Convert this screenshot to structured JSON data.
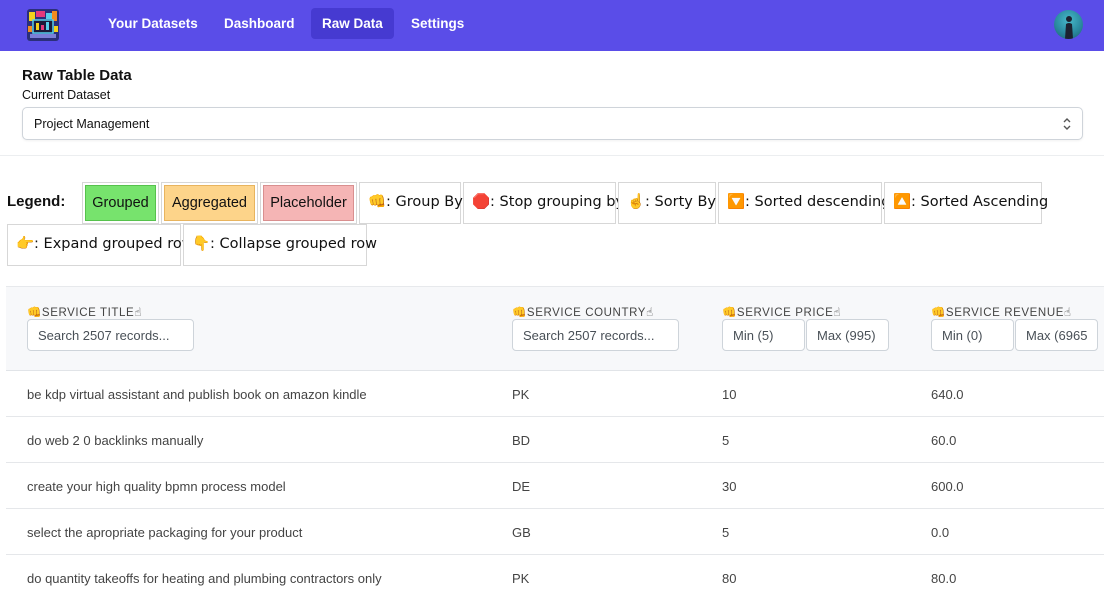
{
  "nav": {
    "items": [
      {
        "label": "Your Datasets",
        "active": false
      },
      {
        "label": "Dashboard",
        "active": false
      },
      {
        "label": "Raw Data",
        "active": true
      },
      {
        "label": "Settings",
        "active": false
      }
    ],
    "bg_color": "#5a4de8",
    "active_color": "#463ad1"
  },
  "header": {
    "title": "Raw Table Data",
    "dataset_label": "Current Dataset",
    "dataset_value": "Project Management"
  },
  "legend": {
    "title": "Legend:",
    "items": [
      {
        "label": "Grouped",
        "color": "#77e36d"
      },
      {
        "label": "Aggregated",
        "color": "#fdd48a"
      },
      {
        "label": "Placeholder",
        "color": "#f5b5b5"
      },
      {
        "label": "👊: Group By"
      },
      {
        "label": "🛑: Stop grouping by"
      },
      {
        "label": "☝️: Sorty By"
      },
      {
        "label": "🔽: Sorted descending"
      },
      {
        "label": "🔼: Sorted Ascending"
      },
      {
        "label": "👉: Expand grouped row"
      },
      {
        "label": "👇: Collapse grouped row"
      }
    ]
  },
  "table": {
    "columns": [
      {
        "title": "SERVICE TITLE",
        "group_icon": "👊",
        "sort_icon": "☝"
      },
      {
        "title": "SERVICE COUNTRY",
        "group_icon": "👊",
        "sort_icon": "☝"
      },
      {
        "title": "SERVICE PRICE",
        "group_icon": "👊",
        "sort_icon": "☝"
      },
      {
        "title": "SERVICE REVENUE",
        "group_icon": "👊",
        "sort_icon": "☝"
      }
    ],
    "filters": {
      "title_placeholder": "Search 2507 records...",
      "country_placeholder": "Search 2507 records...",
      "price_min": "Min (5)",
      "price_max": "Max (995)",
      "revenue_min": "Min (0)",
      "revenue_max": "Max (6965"
    },
    "rows": [
      {
        "title": "be kdp virtual assistant and publish book on amazon kindle",
        "country": "PK",
        "price": "10",
        "revenue": "640.0"
      },
      {
        "title": "do web 2 0 backlinks manually",
        "country": "BD",
        "price": "5",
        "revenue": "60.0"
      },
      {
        "title": "create your high quality bpmn process model",
        "country": "DE",
        "price": "30",
        "revenue": "600.0"
      },
      {
        "title": "select the apropriate packaging for your product",
        "country": "GB",
        "price": "5",
        "revenue": "0.0"
      },
      {
        "title": "do quantity takeoffs for heating and plumbing contractors only",
        "country": "PK",
        "price": "80",
        "revenue": "80.0"
      }
    ]
  }
}
